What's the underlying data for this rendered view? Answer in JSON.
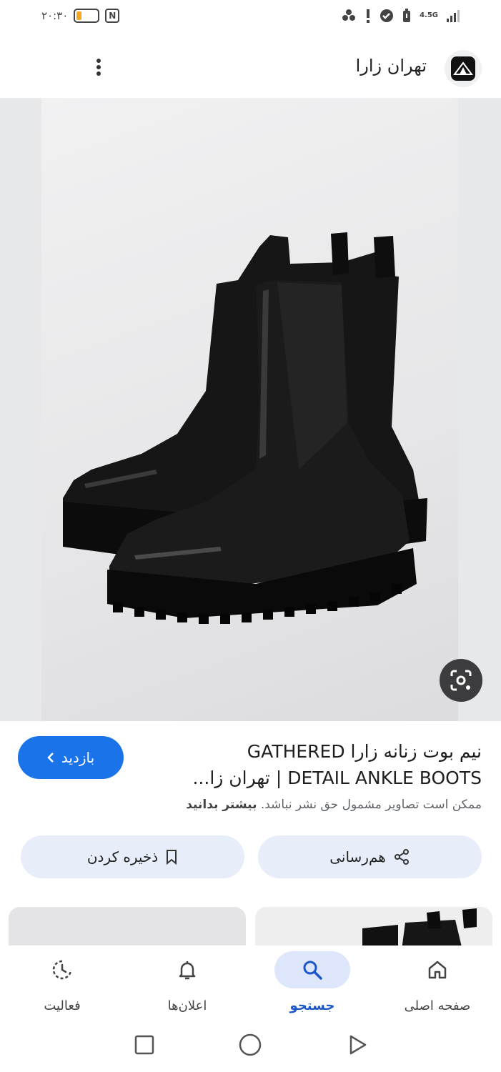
{
  "status_bar": {
    "time": "۲۰:۳۰",
    "battery_level": 0.22,
    "battery_color": "#f5a623",
    "nfc_label": "N",
    "network_type": "4.5G"
  },
  "header": {
    "site_name": "تهران زارا",
    "logo_icon": "tehran-zara-logo",
    "menu_icon": "more-vertical-icon"
  },
  "image": {
    "lens_icon": "google-lens-icon"
  },
  "result": {
    "title": "نیم بوت زنانه زارا GATHERED DETAIL ANKLE BOOTS | تهران زا...",
    "visit_label": "بازدید",
    "copyright_text": "ممکن است تصاویر مشمول حق نشر نباشد.",
    "learn_more": "بیشتر بدانید",
    "share_label": "هم‌رسانی",
    "save_label": "ذخیره کردن"
  },
  "bottom_nav": {
    "items": [
      {
        "label": "صفحه اصلی",
        "icon": "home-icon",
        "active": false
      },
      {
        "label": "جستجو",
        "icon": "search-icon",
        "active": true
      },
      {
        "label": "اعلان‌ها",
        "icon": "bell-icon",
        "active": false
      },
      {
        "label": "فعالیت",
        "icon": "activity-icon",
        "active": false
      }
    ]
  },
  "colors": {
    "accent": "#1a73e8",
    "chip_bg": "#e8eef9",
    "nav_active_bg": "#dde6fb"
  }
}
